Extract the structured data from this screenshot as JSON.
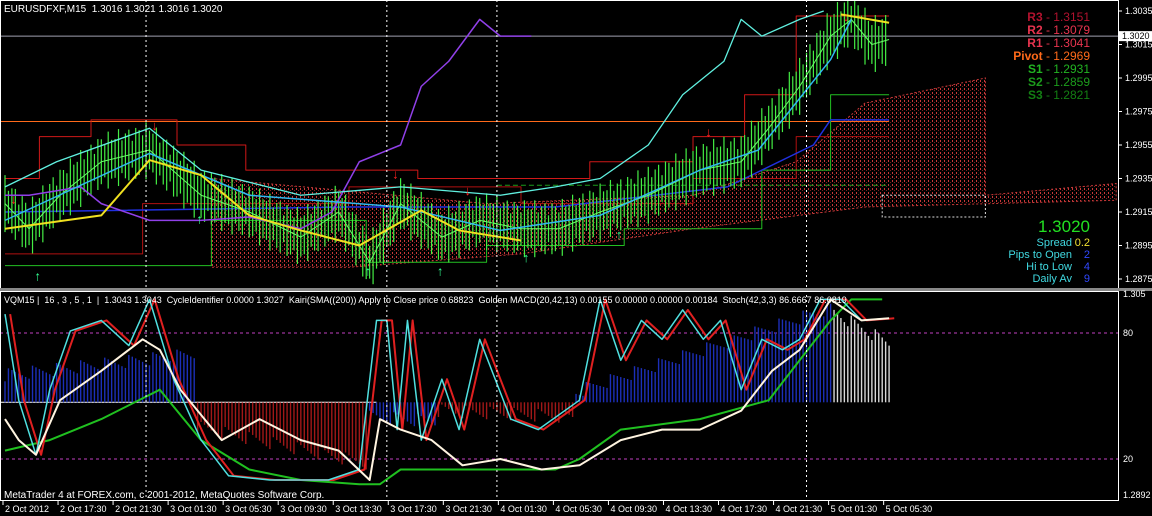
{
  "header": {
    "symbol_line": "EURUSDFXF,M15  1.3016 1.3021 1.3016 1.3020",
    "indicator_line": "VQM15 |  16 , 3 , 5 , 1  |  1.3043 1.3043  CycleIdentifier 0.0000 1.3027  Kairi(SMA((200)) Apply to Close price 0.68823  Golden MACD(20,42,13) 0.00155 0.00000 0.00000 0.00184  Stoch(42,3,3) 86.6667 86.0819",
    "copyright": "MetaTrader 4 at FOREX.com, c 2001-2012, MetaQuotes Software Corp."
  },
  "pivots": [
    {
      "label": "R3",
      "value": "1.3151",
      "color": "#b3122e"
    },
    {
      "label": "R2",
      "value": "1.3079",
      "color": "#e8344f"
    },
    {
      "label": "R1",
      "value": "1.3041",
      "color": "#e8344f"
    },
    {
      "label": "Pivot",
      "value": "1.2969",
      "color": "#ff6a1a"
    },
    {
      "label": "S1",
      "value": "1.2931",
      "color": "#22b422"
    },
    {
      "label": "S2",
      "value": "1.2859",
      "color": "#1c9c1c"
    },
    {
      "label": "S3",
      "value": "1.2821",
      "color": "#137f13"
    }
  ],
  "info": {
    "price": "1.3020",
    "spread_label": "Spread",
    "spread_value": "0.2",
    "pips_label": "Pips to Open",
    "pips_value": "2",
    "hilo_label": "Hi to Low",
    "hilo_value": "4",
    "daily_label": "Daily Av",
    "daily_value": "9"
  },
  "price_axis": {
    "labels": [
      "1.3035",
      "1.3015",
      "1.2995",
      "1.2975",
      "1.2955",
      "1.2935",
      "1.2915",
      "1.2895",
      "1.2875"
    ],
    "current": "1.3020"
  },
  "osc_axis": {
    "top": "1.305",
    "l80": "80",
    "l20": "20",
    "bottom": "1.2892"
  },
  "time_axis": [
    "2 Oct 2012",
    "2 Oct 17:30",
    "2 Oct 21:30",
    "3 Oct 01:30",
    "3 Oct 05:30",
    "3 Oct 09:30",
    "3 Oct 13:30",
    "3 Oct 17:30",
    "3 Oct 21:30",
    "4 Oct 01:30",
    "4 Oct 05:30",
    "4 Oct 09:30",
    "4 Oct 13:30",
    "4 Oct 17:30",
    "4 Oct 21:30",
    "5 Oct 01:30",
    "5 Oct 05:30"
  ],
  "chart_data": {
    "type": "line",
    "x_unit": "bar index (M15)",
    "price_range": [
      1.2875,
      1.3035
    ],
    "levels": {
      "pivot": 1.2969,
      "s1": 1.2931,
      "current": 1.302
    },
    "close": [
      [
        0,
        1.292
      ],
      [
        7,
        1.2905
      ],
      [
        16,
        1.2925
      ],
      [
        28,
        1.2945
      ],
      [
        42,
        1.2952
      ],
      [
        57,
        1.2925
      ],
      [
        71,
        1.2915
      ],
      [
        86,
        1.29
      ],
      [
        97,
        1.2915
      ],
      [
        106,
        1.2885
      ],
      [
        115,
        1.292
      ],
      [
        127,
        1.29
      ],
      [
        138,
        1.291
      ],
      [
        150,
        1.2905
      ],
      [
        161,
        1.2905
      ],
      [
        173,
        1.2915
      ],
      [
        187,
        1.2925
      ],
      [
        202,
        1.294
      ],
      [
        214,
        1.2945
      ],
      [
        222,
        1.2965
      ],
      [
        231,
        1.299
      ],
      [
        240,
        1.302
      ],
      [
        246,
        1.303
      ],
      [
        252,
        1.3015
      ],
      [
        257,
        1.3018
      ]
    ],
    "purple": [
      [
        0,
        1.2925
      ],
      [
        7,
        1.2925
      ],
      [
        22,
        1.293
      ],
      [
        28,
        1.292
      ],
      [
        42,
        1.291
      ],
      [
        57,
        1.291
      ],
      [
        71,
        1.2912
      ],
      [
        86,
        1.2905
      ],
      [
        95,
        1.2915
      ],
      [
        103,
        1.2945
      ],
      [
        115,
        1.2955
      ],
      [
        121,
        1.299
      ],
      [
        129,
        1.3005
      ],
      [
        138,
        1.303
      ],
      [
        144,
        1.302
      ],
      [
        153,
        1.302
      ]
    ],
    "cyan": [
      [
        0,
        1.293
      ],
      [
        15,
        1.2945
      ],
      [
        42,
        1.2965
      ],
      [
        57,
        1.294
      ],
      [
        86,
        1.2925
      ],
      [
        115,
        1.293
      ],
      [
        144,
        1.2925
      ],
      [
        160,
        1.293
      ],
      [
        173,
        1.2935
      ],
      [
        187,
        1.2955
      ],
      [
        197,
        1.2985
      ],
      [
        209,
        1.3005
      ],
      [
        214,
        1.303
      ],
      [
        220,
        1.302
      ],
      [
        231,
        1.303
      ],
      [
        238,
        1.3035
      ]
    ],
    "yellow": [
      [
        0,
        1.2905
      ],
      [
        28,
        1.2913
      ],
      [
        42,
        1.2946
      ],
      [
        57,
        1.2937
      ],
      [
        71,
        1.2913
      ],
      [
        86,
        1.2904
      ],
      [
        103,
        1.2895
      ],
      [
        121,
        1.2916
      ],
      [
        132,
        1.2904
      ],
      [
        150,
        1.2898
      ]
    ],
    "yellow2": [
      [
        243,
        1.3033
      ],
      [
        257,
        1.3028
      ]
    ],
    "lightblue": [
      [
        0,
        1.291
      ],
      [
        42,
        1.295
      ],
      [
        71,
        1.2925
      ],
      [
        115,
        1.2918
      ],
      [
        144,
        1.2904
      ],
      [
        173,
        1.2913
      ],
      [
        202,
        1.294
      ],
      [
        219,
        1.2952
      ],
      [
        240,
        1.3006
      ],
      [
        246,
        1.303
      ]
    ],
    "red_upper": [
      [
        0,
        1.2935
      ],
      [
        10,
        1.2935
      ],
      [
        10,
        1.296
      ],
      [
        25,
        1.296
      ],
      [
        25,
        1.297
      ],
      [
        50,
        1.297
      ],
      [
        50,
        1.2955
      ],
      [
        70,
        1.2955
      ],
      [
        70,
        1.294
      ],
      [
        120,
        1.294
      ],
      [
        120,
        1.2935
      ],
      [
        170,
        1.2935
      ],
      [
        170,
        1.2945
      ],
      [
        200,
        1.2945
      ],
      [
        200,
        1.296
      ],
      [
        215,
        1.296
      ],
      [
        215,
        1.2985
      ],
      [
        230,
        1.2985
      ],
      [
        230,
        1.3032
      ],
      [
        257,
        1.3032
      ]
    ],
    "red_lower": [
      [
        0,
        1.289
      ],
      [
        40,
        1.289
      ],
      [
        40,
        1.292
      ],
      [
        100,
        1.292
      ],
      [
        100,
        1.293
      ],
      [
        150,
        1.293
      ],
      [
        150,
        1.292
      ],
      [
        200,
        1.292
      ],
      [
        200,
        1.2935
      ],
      [
        230,
        1.2935
      ],
      [
        230,
        1.296
      ],
      [
        257,
        1.296
      ]
    ],
    "green_step": [
      [
        0,
        1.2883
      ],
      [
        60,
        1.2883
      ],
      [
        60,
        1.291
      ],
      [
        105,
        1.291
      ],
      [
        105,
        1.2885
      ],
      [
        140,
        1.2885
      ],
      [
        140,
        1.2895
      ],
      [
        180,
        1.2895
      ],
      [
        180,
        1.2905
      ],
      [
        220,
        1.2905
      ],
      [
        220,
        1.294
      ],
      [
        240,
        1.294
      ],
      [
        240,
        1.2985
      ],
      [
        257,
        1.2985
      ]
    ],
    "blue": [
      [
        0,
        1.2915
      ],
      [
        100,
        1.2918
      ],
      [
        160,
        1.2918
      ],
      [
        210,
        1.293
      ],
      [
        235,
        1.2955
      ],
      [
        240,
        1.297
      ],
      [
        257,
        1.297
      ]
    ],
    "cloud": [
      [
        60,
        1.2935
      ],
      [
        140,
        1.292
      ],
      [
        200,
        1.2925
      ],
      [
        230,
        1.2945
      ],
      [
        250,
        1.298
      ],
      [
        285,
        1.2995
      ],
      [
        285,
        1.2925
      ],
      [
        323,
        1.2932
      ],
      [
        323,
        1.2922
      ],
      [
        250,
        1.2918
      ],
      [
        200,
        1.2905
      ],
      [
        150,
        1.289
      ],
      [
        100,
        1.2882
      ],
      [
        60,
        1.2882
      ]
    ],
    "arrows_down": [
      [
        3,
        1.2923
      ],
      [
        44,
        1.2967
      ],
      [
        114,
        1.2938
      ],
      [
        135,
        1.2928
      ],
      [
        205,
        1.2963
      ],
      [
        245,
        1.3032
      ]
    ],
    "arrows_up": [
      [
        10,
        1.2877
      ],
      [
        57,
        1.2911
      ],
      [
        106,
        1.288
      ],
      [
        127,
        1.288
      ],
      [
        152,
        1.2888
      ],
      [
        179,
        1.2902
      ]
    ],
    "osc_range": [
      0,
      100
    ],
    "stoch_main": [
      [
        0,
        89
      ],
      [
        4,
        48
      ],
      [
        9,
        22
      ],
      [
        13,
        53
      ],
      [
        19,
        81
      ],
      [
        28,
        86
      ],
      [
        36,
        74
      ],
      [
        42,
        96
      ],
      [
        49,
        58
      ],
      [
        57,
        29
      ],
      [
        65,
        12
      ],
      [
        77,
        10
      ],
      [
        94,
        10
      ],
      [
        103,
        15
      ],
      [
        108,
        86
      ],
      [
        111,
        86
      ],
      [
        114,
        34
      ],
      [
        117,
        86
      ],
      [
        121,
        29
      ],
      [
        127,
        58
      ],
      [
        132,
        34
      ],
      [
        138,
        77
      ],
      [
        147,
        39
      ],
      [
        155,
        34
      ],
      [
        167,
        48
      ],
      [
        173,
        96
      ],
      [
        179,
        67
      ],
      [
        185,
        86
      ],
      [
        191,
        77
      ],
      [
        197,
        91
      ],
      [
        203,
        77
      ],
      [
        208,
        86
      ],
      [
        214,
        53
      ],
      [
        220,
        77
      ],
      [
        226,
        72
      ],
      [
        231,
        77
      ],
      [
        237,
        96
      ],
      [
        243,
        96
      ],
      [
        249,
        86
      ],
      [
        257,
        87
      ]
    ],
    "white_osc": [
      [
        0,
        39
      ],
      [
        4,
        29
      ],
      [
        9,
        22
      ],
      [
        16,
        48
      ],
      [
        28,
        62
      ],
      [
        40,
        77
      ],
      [
        45,
        72
      ],
      [
        51,
        53
      ],
      [
        63,
        29
      ],
      [
        74,
        39
      ],
      [
        86,
        29
      ],
      [
        97,
        24
      ],
      [
        106,
        10
      ],
      [
        109,
        39
      ],
      [
        115,
        34
      ],
      [
        124,
        29
      ],
      [
        133,
        17
      ],
      [
        144,
        20
      ],
      [
        156,
        15
      ],
      [
        167,
        17
      ],
      [
        179,
        29
      ],
      [
        191,
        34
      ],
      [
        202,
        34
      ],
      [
        214,
        43
      ],
      [
        223,
        62
      ],
      [
        231,
        72
      ],
      [
        240,
        96
      ],
      [
        249,
        86
      ],
      [
        257,
        87
      ]
    ],
    "green_osc": [
      [
        0,
        24
      ],
      [
        13,
        29
      ],
      [
        28,
        39
      ],
      [
        45,
        53
      ],
      [
        57,
        29
      ],
      [
        71,
        15
      ],
      [
        86,
        10
      ],
      [
        103,
        8
      ],
      [
        109,
        8
      ],
      [
        115,
        15
      ],
      [
        129,
        15
      ],
      [
        160,
        15
      ],
      [
        167,
        20
      ],
      [
        179,
        34
      ],
      [
        202,
        39
      ],
      [
        222,
        48
      ],
      [
        231,
        67
      ],
      [
        240,
        86
      ],
      [
        246,
        96
      ],
      [
        255,
        96
      ]
    ],
    "histogram_zero": 47,
    "histogram": [
      {
        "from": 0,
        "to": 55,
        "start": 60,
        "end": 70,
        "color": "#1c2fb8"
      },
      {
        "from": 56,
        "to": 105,
        "start": 35,
        "end": 18,
        "color": "#a01818"
      },
      {
        "from": 106,
        "to": 125,
        "start": 40,
        "end": 38,
        "color": "#1c2fb8"
      },
      {
        "from": 126,
        "to": 165,
        "start": 43,
        "end": 40,
        "color": "#a01818"
      },
      {
        "from": 166,
        "to": 240,
        "start": 52,
        "end": 92,
        "color": "#1c2fb8"
      },
      {
        "from": 241,
        "to": 257,
        "start": 90,
        "end": 75,
        "color": "#d8d8d8"
      }
    ],
    "current_marker": [
      [
        243,
        1.302
      ]
    ]
  }
}
